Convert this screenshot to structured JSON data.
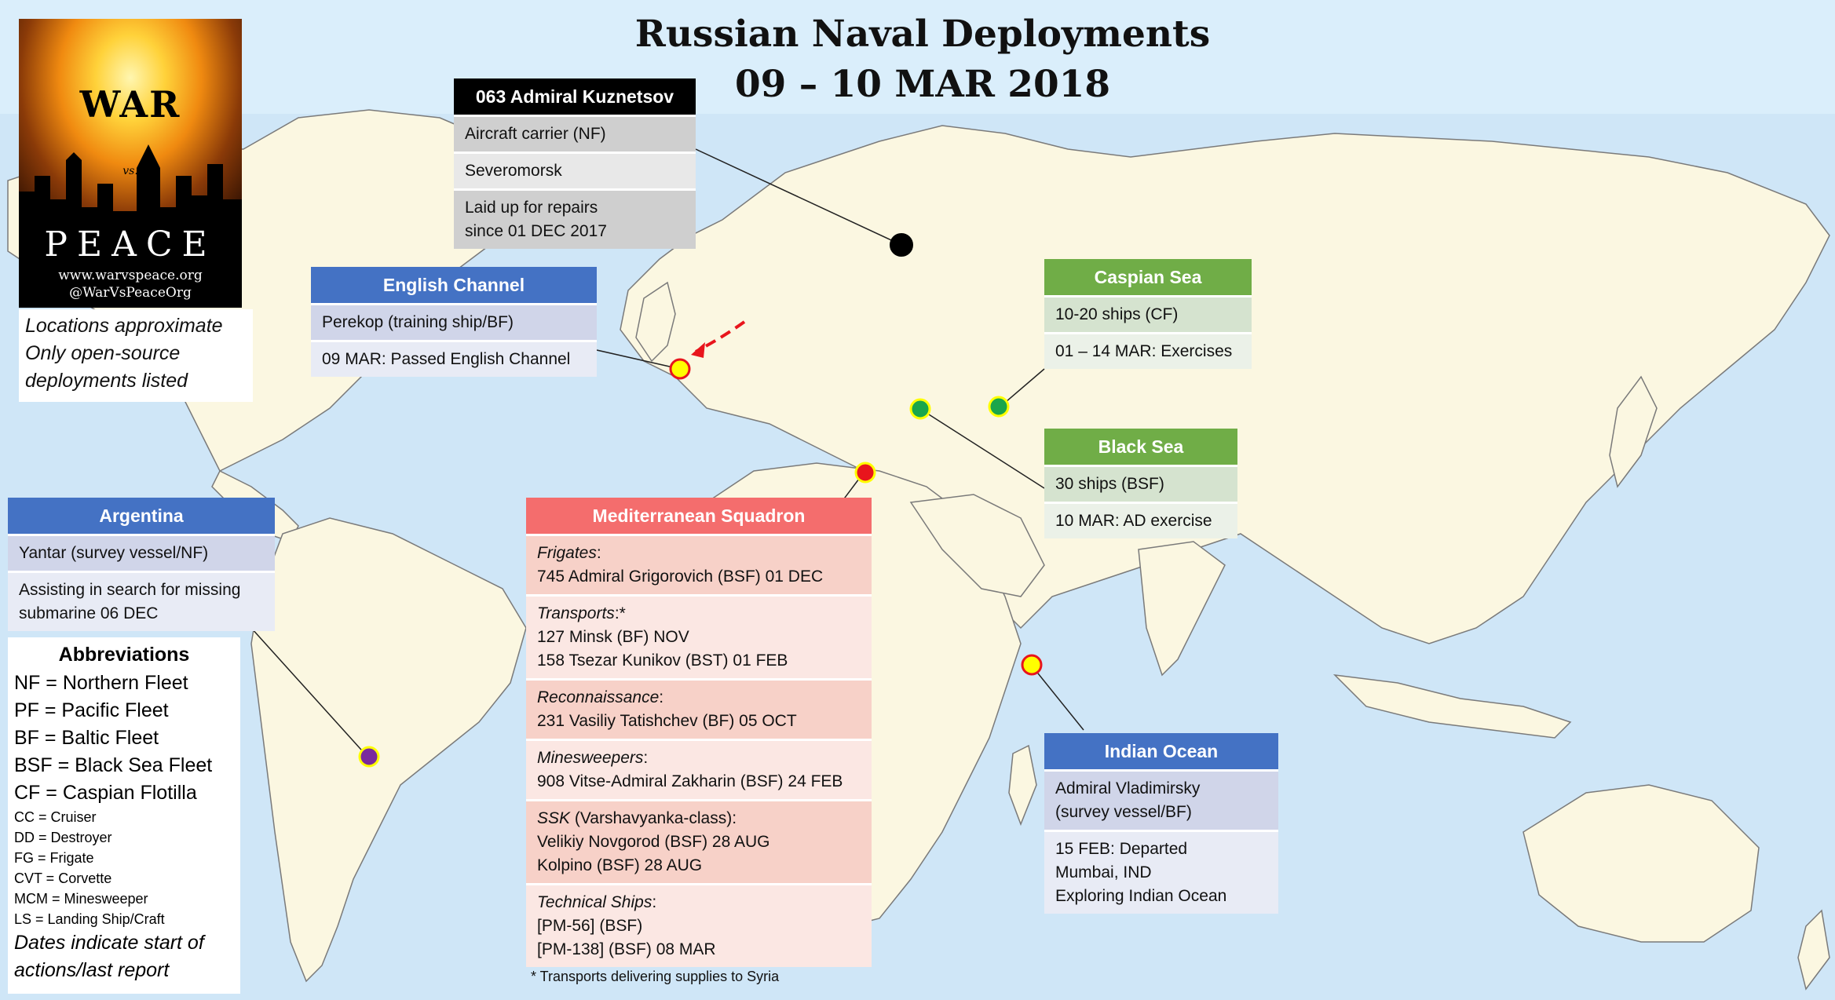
{
  "title": {
    "line1": "Russian Naval Deployments",
    "line2": "09 – 10 MAR 2018"
  },
  "logo": {
    "war": "WAR",
    "vs": "vs.",
    "peace": "PEACE",
    "site": "www.warvspeace.org",
    "handle": "@WarVsPeaceOrg"
  },
  "note": {
    "line1": "Locations approximate",
    "line2": "Only open-source",
    "line3": "deployments listed"
  },
  "kuznetsov": {
    "header": "063 Admiral Kuznetsov",
    "rows": [
      "Aircraft carrier (NF)",
      "Severomorsk",
      "Laid up for repairs",
      "since 01 DEC 2017"
    ]
  },
  "english_channel": {
    "header": "English Channel",
    "rows": [
      "Perekop (training ship/BF)",
      "09 MAR: Passed English Channel"
    ]
  },
  "caspian": {
    "header": "Caspian Sea",
    "rows": [
      "10-20 ships (CF)",
      "01 – 14 MAR: Exercises"
    ]
  },
  "black_sea": {
    "header": "Black Sea",
    "rows": [
      "30 ships (BSF)",
      "10 MAR: AD exercise"
    ]
  },
  "argentina": {
    "header": "Argentina",
    "rows": [
      "Yantar (survey vessel/NF)",
      "Assisting in search for missing",
      "submarine 06 DEC"
    ]
  },
  "indian_ocean": {
    "header": "Indian Ocean",
    "rows": [
      "Admiral Vladimirsky",
      "(survey vessel/BF)",
      "15 FEB: Departed",
      "Mumbai, IND",
      "Exploring Indian Ocean"
    ]
  },
  "med": {
    "header": "Mediterranean Squadron",
    "sections": [
      {
        "category": "Frigates",
        "suffix": ":",
        "lines": [
          "745 Admiral Grigorovich (BSF) 01 DEC"
        ]
      },
      {
        "category": "Transports",
        "suffix": ":*",
        "lines": [
          "127 Minsk (BF) NOV",
          "158 Tsezar Kunikov (BST) 01 FEB"
        ]
      },
      {
        "category": "Reconnaissance",
        "suffix": ":",
        "lines": [
          "231 Vasiliy Tatishchev (BF) 05 OCT"
        ]
      },
      {
        "category": "Minesweepers",
        "suffix": ":",
        "lines": [
          "908 Vitse-Admiral Zakharin (BSF) 24 FEB"
        ]
      },
      {
        "category": "SSK",
        "suffix": " (Varshavyanka-class):",
        "lines": [
          "Velikiy Novgorod (BSF) 28 AUG",
          "Kolpino (BSF) 28 AUG"
        ]
      },
      {
        "category": "Technical Ships",
        "suffix": ":",
        "lines": [
          "[PM-56] (BSF)",
          "[PM-138] (BSF) 08 MAR"
        ]
      }
    ],
    "footnote": "* Transports delivering supplies to Syria"
  },
  "abbreviations": {
    "header": "Abbreviations",
    "major": [
      "NF = Northern Fleet",
      "PF = Pacific Fleet",
      "BF = Baltic Fleet",
      "BSF = Black Sea Fleet",
      "CF = Caspian Flotilla"
    ],
    "minor": [
      "CC = Cruiser",
      "DD = Destroyer",
      "FG = Frigate",
      "CVT = Corvette",
      "MCM = Minesweeper",
      "LS = Landing Ship/Craft"
    ],
    "note": [
      "Dates indicate start of",
      "actions/last report"
    ]
  },
  "colors": {
    "ocean": "#cfe6f7",
    "land": "#fbf7e1",
    "border": "#8a8a8a",
    "marker_red": "#e8151c",
    "marker_yellow": "#ffff00",
    "marker_green": "#1aa64b",
    "marker_purple": "#7a2a9e"
  },
  "icons": [
    "mushroom-cloud-icon",
    "city-skyline-icon"
  ]
}
